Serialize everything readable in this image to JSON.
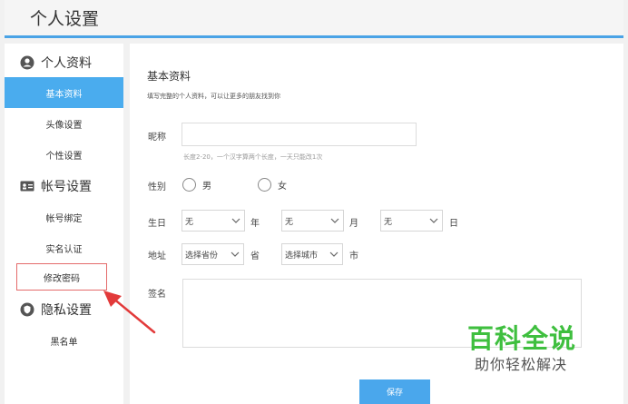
{
  "header": {
    "title": "个人设置"
  },
  "sidebar": {
    "sections": [
      {
        "title": "个人资料",
        "icon": "user-icon",
        "items": [
          "基本资料",
          "头像设置",
          "个性设置"
        ]
      },
      {
        "title": "帐号设置",
        "icon": "id-card-icon",
        "items": [
          "帐号绑定",
          "实名认证",
          "修改密码"
        ]
      },
      {
        "title": "隐私设置",
        "icon": "shield-icon",
        "items": [
          "黑名单"
        ]
      }
    ],
    "active_item": "基本资料",
    "highlighted_item": "修改密码"
  },
  "main": {
    "heading": "基本资料",
    "subheading": "填写完整的个人资料，可以让更多的朋友找到你",
    "nickname": {
      "label": "昵称",
      "value": "",
      "hint": "长度2-20，一个汉字算两个长度，一天只能改1次"
    },
    "gender": {
      "label": "性别",
      "options": [
        "男",
        "女"
      ]
    },
    "birthday": {
      "label": "生日",
      "year": "无",
      "year_unit": "年",
      "month": "无",
      "month_unit": "月",
      "day": "无",
      "day_unit": "日"
    },
    "address": {
      "label": "地址",
      "province": "选择省份",
      "province_unit": "省",
      "city": "选择城市",
      "city_unit": "市"
    },
    "signature": {
      "label": "签名",
      "value": ""
    },
    "save_label": "保存"
  },
  "watermark": {
    "title": "百科全说",
    "subtitle": "助你轻松解决"
  },
  "colors": {
    "accent": "#4aacee",
    "highlight_border": "#e46b6b",
    "arrow": "#e23a3a",
    "watermark": "#3fbf3f"
  }
}
